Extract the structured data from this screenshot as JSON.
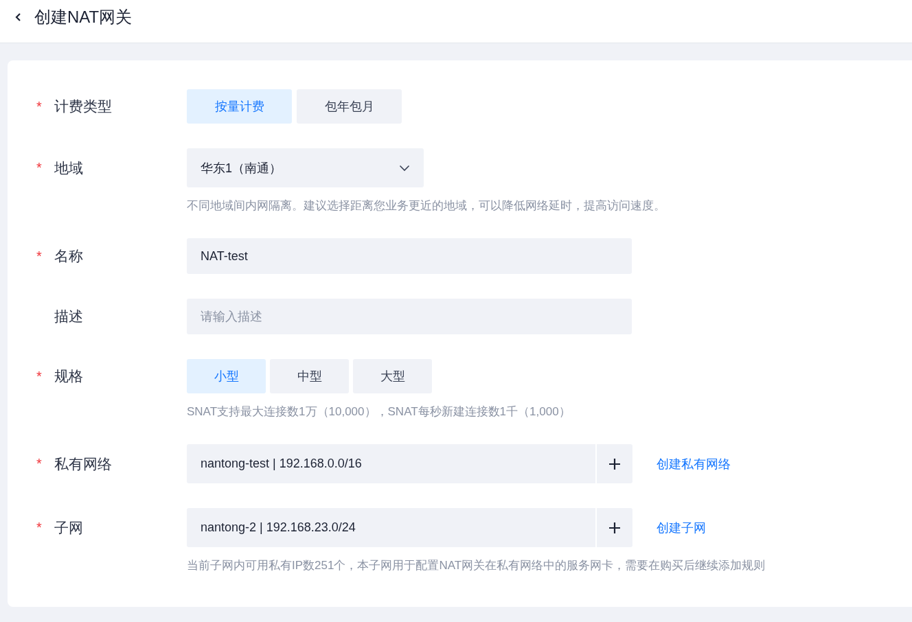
{
  "header": {
    "title": "创建NAT网关"
  },
  "form": {
    "rows": [
      {
        "kind": "segmented",
        "required_mark": "*",
        "label": "计费类型",
        "options": [
          {
            "label": "按量计费",
            "selected": true
          },
          {
            "label": "包年包月",
            "selected": false
          }
        ]
      },
      {
        "kind": "select",
        "required_mark": "*",
        "label": "地域",
        "value": "华东1（南通）",
        "hint": "不同地域间内网隔离。建议选择距离您业务更近的地域，可以降低网络延时，提高访问速度。"
      },
      {
        "kind": "input",
        "required_mark": "*",
        "label": "名称",
        "value": "NAT-test"
      },
      {
        "kind": "input",
        "label": "描述",
        "placeholder": "请输入描述"
      },
      {
        "kind": "segmented",
        "required_mark": "*",
        "label": "规格",
        "options": [
          {
            "label": "小型",
            "selected": true
          },
          {
            "label": "中型",
            "selected": false
          },
          {
            "label": "大型",
            "selected": false
          }
        ],
        "hint": "SNAT支持最大连接数1万（10,000），SNAT每秒新建连接数1千（1,000）"
      },
      {
        "kind": "combo",
        "required_mark": "*",
        "label": "私有网络",
        "value": "nantong-test | 192.168.0.0/16",
        "link": "创建私有网络"
      },
      {
        "kind": "combo",
        "required_mark": "*",
        "label": "子网",
        "value": "nantong-2 | 192.168.23.0/24",
        "link": "创建子网",
        "hint": "当前子网内可用私有IP数251个，本子网用于配置NAT网关在私有网络中的服务网卡，需要在购买后继续添加规则"
      }
    ]
  }
}
